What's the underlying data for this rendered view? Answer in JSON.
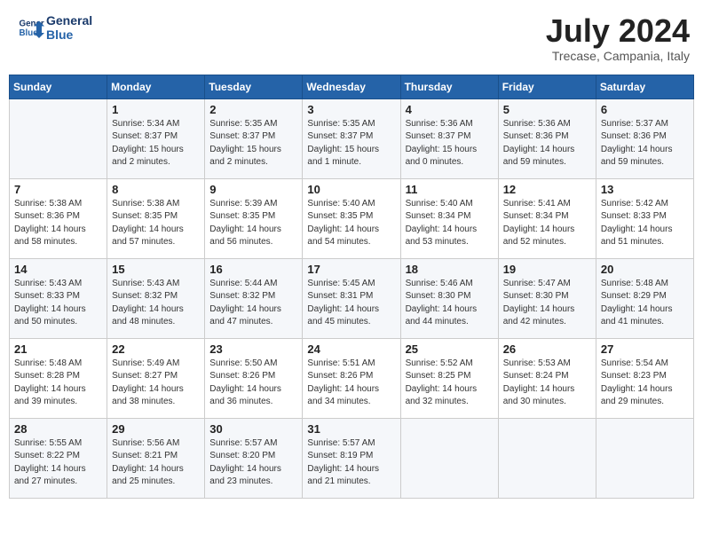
{
  "header": {
    "logo_line1": "General",
    "logo_line2": "Blue",
    "month": "July 2024",
    "location": "Trecase, Campania, Italy"
  },
  "weekdays": [
    "Sunday",
    "Monday",
    "Tuesday",
    "Wednesday",
    "Thursday",
    "Friday",
    "Saturday"
  ],
  "weeks": [
    [
      {
        "day": "",
        "content": ""
      },
      {
        "day": "1",
        "content": "Sunrise: 5:34 AM\nSunset: 8:37 PM\nDaylight: 15 hours\nand 2 minutes."
      },
      {
        "day": "2",
        "content": "Sunrise: 5:35 AM\nSunset: 8:37 PM\nDaylight: 15 hours\nand 2 minutes."
      },
      {
        "day": "3",
        "content": "Sunrise: 5:35 AM\nSunset: 8:37 PM\nDaylight: 15 hours\nand 1 minute."
      },
      {
        "day": "4",
        "content": "Sunrise: 5:36 AM\nSunset: 8:37 PM\nDaylight: 15 hours\nand 0 minutes."
      },
      {
        "day": "5",
        "content": "Sunrise: 5:36 AM\nSunset: 8:36 PM\nDaylight: 14 hours\nand 59 minutes."
      },
      {
        "day": "6",
        "content": "Sunrise: 5:37 AM\nSunset: 8:36 PM\nDaylight: 14 hours\nand 59 minutes."
      }
    ],
    [
      {
        "day": "7",
        "content": "Sunrise: 5:38 AM\nSunset: 8:36 PM\nDaylight: 14 hours\nand 58 minutes."
      },
      {
        "day": "8",
        "content": "Sunrise: 5:38 AM\nSunset: 8:35 PM\nDaylight: 14 hours\nand 57 minutes."
      },
      {
        "day": "9",
        "content": "Sunrise: 5:39 AM\nSunset: 8:35 PM\nDaylight: 14 hours\nand 56 minutes."
      },
      {
        "day": "10",
        "content": "Sunrise: 5:40 AM\nSunset: 8:35 PM\nDaylight: 14 hours\nand 54 minutes."
      },
      {
        "day": "11",
        "content": "Sunrise: 5:40 AM\nSunset: 8:34 PM\nDaylight: 14 hours\nand 53 minutes."
      },
      {
        "day": "12",
        "content": "Sunrise: 5:41 AM\nSunset: 8:34 PM\nDaylight: 14 hours\nand 52 minutes."
      },
      {
        "day": "13",
        "content": "Sunrise: 5:42 AM\nSunset: 8:33 PM\nDaylight: 14 hours\nand 51 minutes."
      }
    ],
    [
      {
        "day": "14",
        "content": "Sunrise: 5:43 AM\nSunset: 8:33 PM\nDaylight: 14 hours\nand 50 minutes."
      },
      {
        "day": "15",
        "content": "Sunrise: 5:43 AM\nSunset: 8:32 PM\nDaylight: 14 hours\nand 48 minutes."
      },
      {
        "day": "16",
        "content": "Sunrise: 5:44 AM\nSunset: 8:32 PM\nDaylight: 14 hours\nand 47 minutes."
      },
      {
        "day": "17",
        "content": "Sunrise: 5:45 AM\nSunset: 8:31 PM\nDaylight: 14 hours\nand 45 minutes."
      },
      {
        "day": "18",
        "content": "Sunrise: 5:46 AM\nSunset: 8:30 PM\nDaylight: 14 hours\nand 44 minutes."
      },
      {
        "day": "19",
        "content": "Sunrise: 5:47 AM\nSunset: 8:30 PM\nDaylight: 14 hours\nand 42 minutes."
      },
      {
        "day": "20",
        "content": "Sunrise: 5:48 AM\nSunset: 8:29 PM\nDaylight: 14 hours\nand 41 minutes."
      }
    ],
    [
      {
        "day": "21",
        "content": "Sunrise: 5:48 AM\nSunset: 8:28 PM\nDaylight: 14 hours\nand 39 minutes."
      },
      {
        "day": "22",
        "content": "Sunrise: 5:49 AM\nSunset: 8:27 PM\nDaylight: 14 hours\nand 38 minutes."
      },
      {
        "day": "23",
        "content": "Sunrise: 5:50 AM\nSunset: 8:26 PM\nDaylight: 14 hours\nand 36 minutes."
      },
      {
        "day": "24",
        "content": "Sunrise: 5:51 AM\nSunset: 8:26 PM\nDaylight: 14 hours\nand 34 minutes."
      },
      {
        "day": "25",
        "content": "Sunrise: 5:52 AM\nSunset: 8:25 PM\nDaylight: 14 hours\nand 32 minutes."
      },
      {
        "day": "26",
        "content": "Sunrise: 5:53 AM\nSunset: 8:24 PM\nDaylight: 14 hours\nand 30 minutes."
      },
      {
        "day": "27",
        "content": "Sunrise: 5:54 AM\nSunset: 8:23 PM\nDaylight: 14 hours\nand 29 minutes."
      }
    ],
    [
      {
        "day": "28",
        "content": "Sunrise: 5:55 AM\nSunset: 8:22 PM\nDaylight: 14 hours\nand 27 minutes."
      },
      {
        "day": "29",
        "content": "Sunrise: 5:56 AM\nSunset: 8:21 PM\nDaylight: 14 hours\nand 25 minutes."
      },
      {
        "day": "30",
        "content": "Sunrise: 5:57 AM\nSunset: 8:20 PM\nDaylight: 14 hours\nand 23 minutes."
      },
      {
        "day": "31",
        "content": "Sunrise: 5:57 AM\nSunset: 8:19 PM\nDaylight: 14 hours\nand 21 minutes."
      },
      {
        "day": "",
        "content": ""
      },
      {
        "day": "",
        "content": ""
      },
      {
        "day": "",
        "content": ""
      }
    ]
  ]
}
